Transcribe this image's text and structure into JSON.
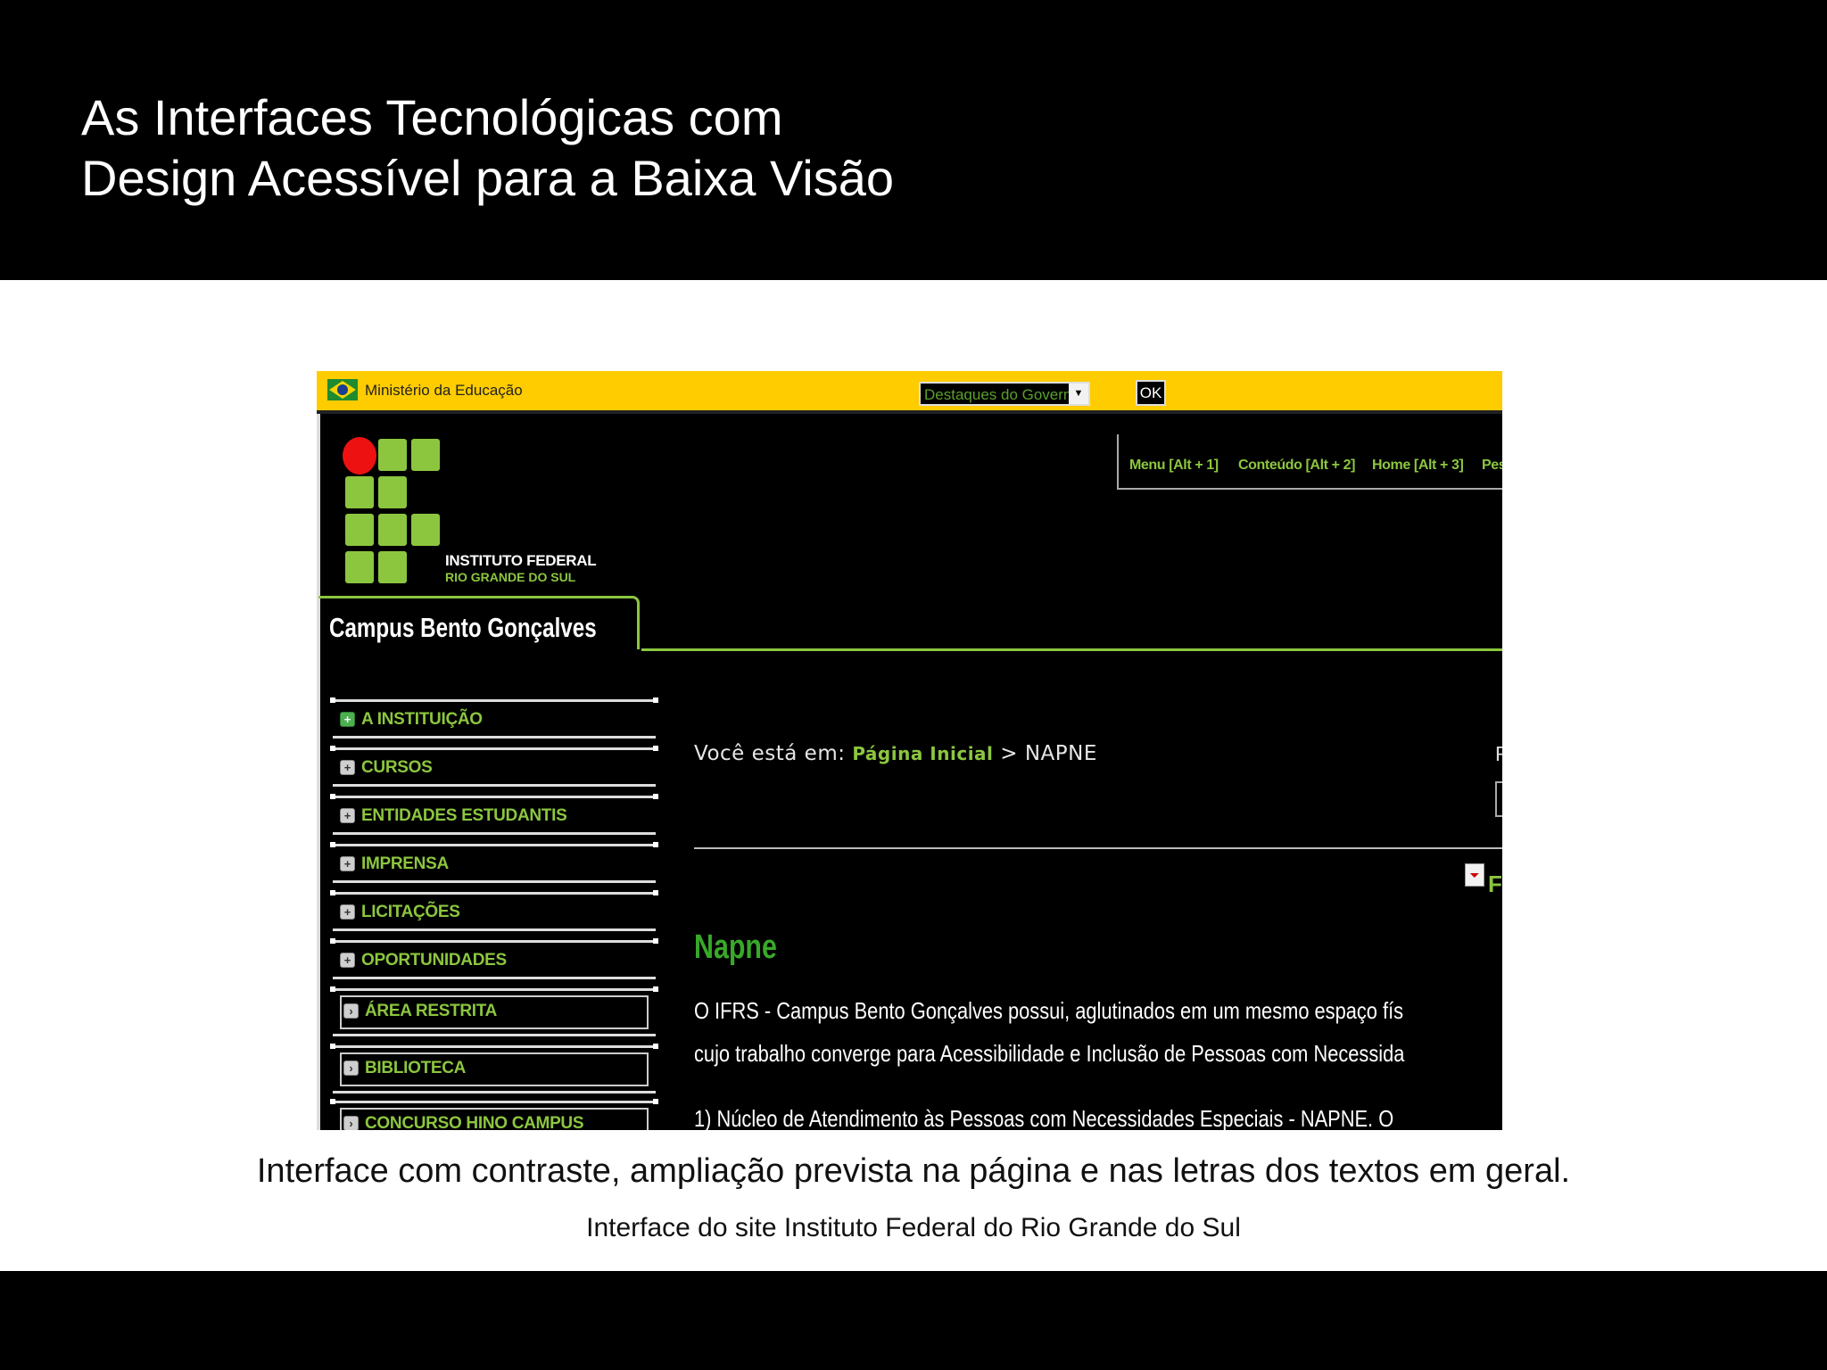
{
  "slide": {
    "title_lines": [
      "As Interfaces Tecnológicas com",
      "Design Acessível para a Baixa Visão"
    ],
    "caption": "Interface  com contraste, ampliação prevista na página e nas letras dos textos em geral.",
    "credit": "Interface do site Instituto Federal do Rio Grande do Sul"
  },
  "screenshot": {
    "gov_bar": {
      "ministry": "Ministério da Educação",
      "select_value": "Destaques do Governo",
      "ok_label": "OK",
      "color": "#ffcc00"
    },
    "institute": {
      "name": "INSTITUTO FEDERAL",
      "subname": "RIO GRANDE DO SUL"
    },
    "access_links": [
      "Menu [Alt + 1]",
      "Conteúdo [Alt + 2]",
      "Home [Alt + 3]",
      "Pes"
    ],
    "campus_title": "Campus Bento Gonçalves",
    "menu": [
      {
        "label": "A INSTITUIÇÃO",
        "icon": "plus-icon"
      },
      {
        "label": "CURSOS",
        "icon": "plus-icon"
      },
      {
        "label": "ENTIDADES ESTUDANTIS",
        "icon": "plus-icon"
      },
      {
        "label": "IMPRENSA",
        "icon": "plus-icon"
      },
      {
        "label": "LICITAÇÕES",
        "icon": "plus-icon"
      },
      {
        "label": "OPORTUNIDADES",
        "icon": "plus-icon"
      },
      {
        "label": "ÁREA RESTRITA",
        "icon": "arrow-icon"
      },
      {
        "label": "BIBLIOTECA",
        "icon": "arrow-icon"
      },
      {
        "label": "CONCURSO HINO CAMPUS",
        "icon": "arrow-icon"
      }
    ],
    "breadcrumb": {
      "prefix": "Você está em:",
      "link": "Página Inicial",
      "separator": ">",
      "current": "NAPNE"
    },
    "right_fragment_1": "F",
    "right_fragment_2": "F",
    "heading": "Napne",
    "paragraphs": [
      "O IFRS - Campus Bento Gonçalves possui, aglutinados em um mesmo espaço fís",
      "cujo trabalho converge para Acessibilidade e Inclusão de Pessoas com Necessida",
      "1) Núcleo de Atendimento às Pessoas com Necessidades Especiais - NAPNE. O"
    ],
    "colors": {
      "accent_green": "#8cc63f",
      "heading_green": "#39a82a",
      "logo_red": "#ee1111",
      "background": "#000000"
    }
  }
}
